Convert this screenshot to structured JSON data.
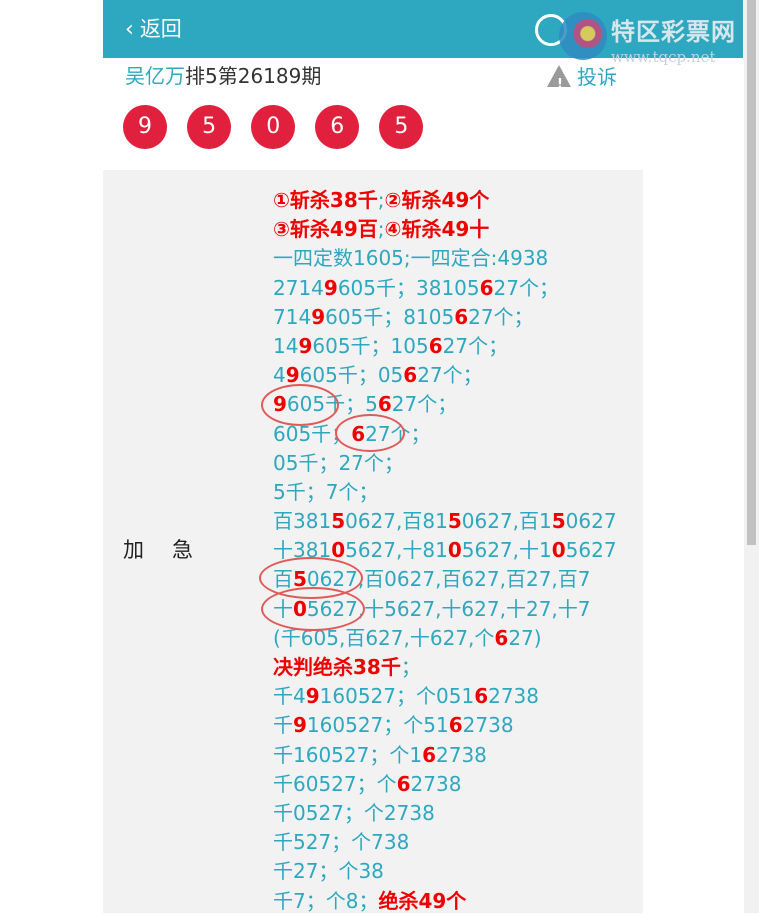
{
  "header": {
    "back_label": "返回",
    "site_name": "特区彩票网",
    "site_url": "www.tqcp.net"
  },
  "post": {
    "author": "吴亿万",
    "issue": "排5第26189期",
    "report_label": "投诉"
  },
  "balls": [
    "9",
    "5",
    "0",
    "6",
    "5"
  ],
  "card": {
    "label": "加急",
    "lines": [
      [
        {
          "t": "①斩杀38千",
          "c": "b"
        },
        {
          "t": ";",
          "c": ""
        },
        {
          "t": "②斩杀49个",
          "c": "b"
        }
      ],
      [
        {
          "t": "③斩杀49百",
          "c": "b"
        },
        {
          "t": ";",
          "c": ""
        },
        {
          "t": "④斩杀49十",
          "c": "b"
        }
      ],
      [
        {
          "t": "一四定数1605;一四定合:4938",
          "c": ""
        }
      ],
      [
        {
          "t": "2714",
          "c": ""
        },
        {
          "t": "9",
          "c": "r"
        },
        {
          "t": "605千；38105",
          "c": ""
        },
        {
          "t": "6",
          "c": "r"
        },
        {
          "t": "27个；",
          "c": ""
        }
      ],
      [
        {
          "t": "714",
          "c": ""
        },
        {
          "t": "9",
          "c": "r"
        },
        {
          "t": "605千；8105",
          "c": ""
        },
        {
          "t": "6",
          "c": "r"
        },
        {
          "t": "27个；",
          "c": ""
        }
      ],
      [
        {
          "t": "14",
          "c": ""
        },
        {
          "t": "9",
          "c": "r"
        },
        {
          "t": "605千；105",
          "c": ""
        },
        {
          "t": "6",
          "c": "r"
        },
        {
          "t": "27个；",
          "c": ""
        }
      ],
      [
        {
          "t": "4",
          "c": ""
        },
        {
          "t": "9",
          "c": "r"
        },
        {
          "t": "605千；05",
          "c": ""
        },
        {
          "t": "6",
          "c": "r"
        },
        {
          "t": "27个；",
          "c": ""
        }
      ],
      [
        {
          "t": "9",
          "c": "r"
        },
        {
          "t": "605千；5",
          "c": ""
        },
        {
          "t": "6",
          "c": "r"
        },
        {
          "t": "27个；",
          "c": ""
        }
      ],
      [
        {
          "t": "605千；",
          "c": ""
        },
        {
          "t": "6",
          "c": "r"
        },
        {
          "t": "27个；",
          "c": ""
        }
      ],
      [
        {
          "t": "05千；27个；",
          "c": ""
        }
      ],
      [
        {
          "t": "5千；7个；",
          "c": ""
        }
      ],
      [
        {
          "t": "百381",
          "c": ""
        },
        {
          "t": "5",
          "c": "r"
        },
        {
          "t": "0627,百81",
          "c": ""
        },
        {
          "t": "5",
          "c": "r"
        },
        {
          "t": "0627,百1",
          "c": ""
        },
        {
          "t": "5",
          "c": "r"
        },
        {
          "t": "0627",
          "c": ""
        }
      ],
      [
        {
          "t": "十381",
          "c": ""
        },
        {
          "t": "0",
          "c": "r"
        },
        {
          "t": "5627,十81",
          "c": ""
        },
        {
          "t": "0",
          "c": "r"
        },
        {
          "t": "5627,十1",
          "c": ""
        },
        {
          "t": "0",
          "c": "r"
        },
        {
          "t": "5627",
          "c": ""
        }
      ],
      [
        {
          "t": "百",
          "c": ""
        },
        {
          "t": "5",
          "c": "r"
        },
        {
          "t": "0627,百0627,百627,百27,百7",
          "c": ""
        }
      ],
      [
        {
          "t": "十",
          "c": ""
        },
        {
          "t": "0",
          "c": "r"
        },
        {
          "t": "5627,十5627,十627,十27,十7",
          "c": ""
        }
      ],
      [
        {
          "t": "(千605,百627,十627,个",
          "c": ""
        },
        {
          "t": "6",
          "c": "r"
        },
        {
          "t": "27)",
          "c": ""
        }
      ],
      [
        {
          "t": "决判绝杀38千",
          "c": "b"
        },
        {
          "t": "；",
          "c": ""
        }
      ],
      [
        {
          "t": "千4",
          "c": ""
        },
        {
          "t": "9",
          "c": "r"
        },
        {
          "t": "160527；个051",
          "c": ""
        },
        {
          "t": "6",
          "c": "r"
        },
        {
          "t": "2738",
          "c": ""
        }
      ],
      [
        {
          "t": "千",
          "c": ""
        },
        {
          "t": "9",
          "c": "r"
        },
        {
          "t": "160527；个51",
          "c": ""
        },
        {
          "t": "6",
          "c": "r"
        },
        {
          "t": "2738",
          "c": ""
        }
      ],
      [
        {
          "t": "千160527；个1",
          "c": ""
        },
        {
          "t": "6",
          "c": "r"
        },
        {
          "t": "2738",
          "c": ""
        }
      ],
      [
        {
          "t": "千60527；个",
          "c": ""
        },
        {
          "t": "6",
          "c": "r"
        },
        {
          "t": "2738",
          "c": ""
        }
      ],
      [
        {
          "t": "千0527；个2738",
          "c": ""
        }
      ],
      [
        {
          "t": "千527；个738",
          "c": ""
        }
      ],
      [
        {
          "t": "千27；个38",
          "c": ""
        }
      ],
      [
        {
          "t": "千7；个8；",
          "c": ""
        },
        {
          "t": "绝杀49个",
          "c": "b"
        }
      ]
    ]
  },
  "colors": {
    "accent": "#2ea7c0",
    "ball": "#e0203c",
    "highlight": "#ee0000"
  }
}
